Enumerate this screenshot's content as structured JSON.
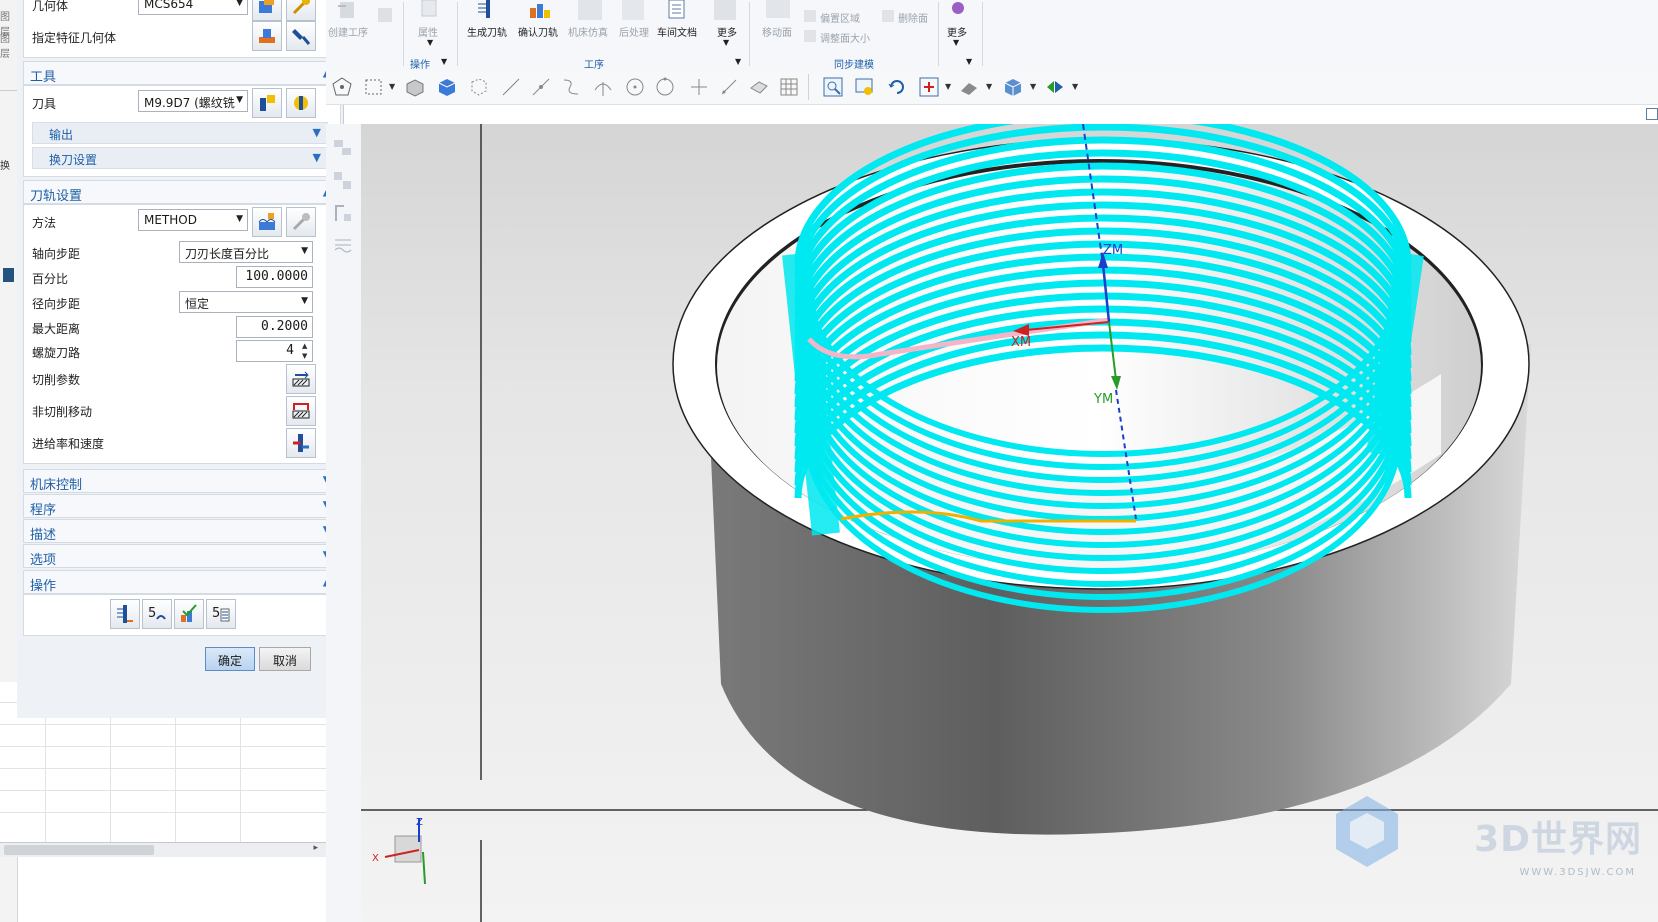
{
  "leftstrip": {
    "labels": [
      "图层",
      "图层",
      "换"
    ]
  },
  "dialog": {
    "geometry_row": {
      "label": "几何体",
      "value": "MCS654"
    },
    "feature_row": {
      "label": "指定特征几何体"
    },
    "tool_section": {
      "title": "工具",
      "tool_label": "刀具",
      "tool_value": "M9.9D7 (螺纹铣",
      "output_label": "输出",
      "toolchange_label": "换刀设置"
    },
    "path_section": {
      "title": "刀轨设置",
      "method_label": "方法",
      "method_value": "METHOD",
      "axial_step_label": "轴向步距",
      "axial_step_value": "刀刃长度百分比",
      "percent_label": "百分比",
      "percent_value": "100.0000",
      "radial_step_label": "径向步距",
      "radial_step_value": "恒定",
      "max_dist_label": "最大距离",
      "max_dist_value": "0.2000",
      "spiral_label": "螺旋刀路",
      "spiral_value": "4",
      "cut_params_label": "切削参数",
      "noncut_label": "非切削移动",
      "feeds_label": "进给率和速度"
    },
    "collapsed_sections": [
      "机床控制",
      "程序",
      "描述",
      "选项"
    ],
    "ops_section": {
      "title": "操作"
    },
    "ok_label": "确定",
    "cancel_label": "取消"
  },
  "ribbon": {
    "items": [
      {
        "label": "创建工序",
        "enabled": false
      },
      {
        "label": "属性",
        "enabled": false
      },
      {
        "label": "生成刀轨",
        "enabled": true
      },
      {
        "label": "确认刀轨",
        "enabled": true
      },
      {
        "label": "机床仿真",
        "enabled": false
      },
      {
        "label": "后处理",
        "enabled": false
      },
      {
        "label": "车间文档",
        "enabled": true
      },
      {
        "label": "更多",
        "enabled": true
      },
      {
        "label": "移动面",
        "enabled": false
      },
      {
        "label": "偏置区域",
        "enabled": false
      },
      {
        "label": "调整面大小",
        "enabled": false
      },
      {
        "label": "删除面",
        "enabled": false
      },
      {
        "label": "更多",
        "enabled": true
      }
    ],
    "groups": [
      "操作",
      "工序",
      "同步建模"
    ]
  },
  "viewport": {
    "axis_labels": {
      "zm": "ZM",
      "xm": "XM",
      "ym": "YM"
    },
    "triad": {
      "x": "X",
      "z": "Z"
    },
    "colors": {
      "toolpath": "#00e8f0",
      "xm": "#cc2222",
      "ym": "#2a9a2a",
      "zm": "#1a3fcc",
      "engage": "#f0b000",
      "lead": "#f3b6c8"
    },
    "watermark": "3D世界网",
    "watermark_url": "WWW.3DSJW.COM"
  }
}
